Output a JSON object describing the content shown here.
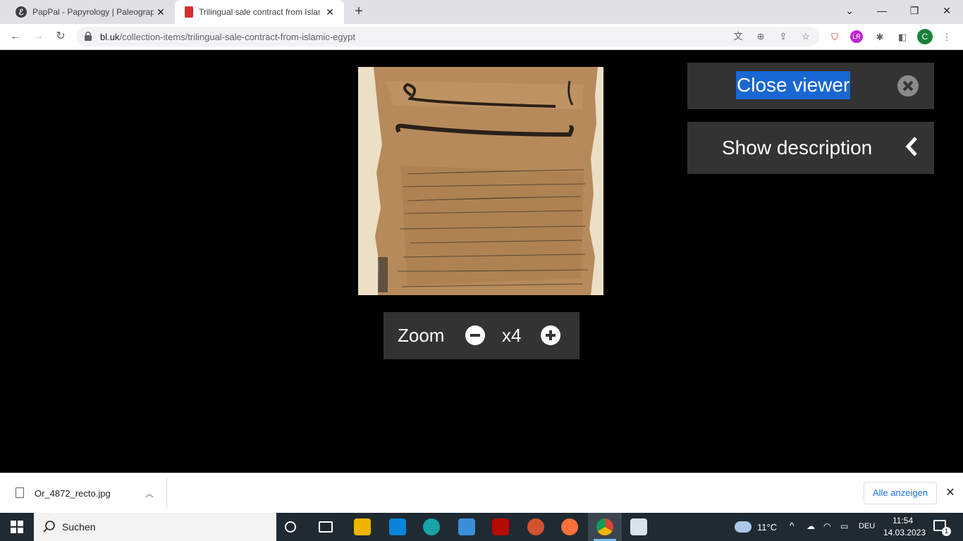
{
  "browser": {
    "tabs": [
      {
        "title": "PapPal - Papyrology | Paleograph",
        "icon": "pappal-favicon"
      },
      {
        "title": "Trilingual sale contract from Islan",
        "icon": "bl-favicon"
      }
    ],
    "url_host": "bl.uk",
    "url_path": "/collection-items/trilingual-sale-contract-from-islamic-egypt",
    "profile_initial": "C"
  },
  "viewer": {
    "close_label": "Close viewer",
    "show_description_label": "Show description",
    "zoom_label": "Zoom",
    "zoom_level": "x4",
    "image_alt": "Or_4872 recto papyrus"
  },
  "downloads": {
    "filename": "Or_4872_recto.jpg",
    "show_all_label": "Alle anzeigen"
  },
  "taskbar": {
    "search_label": "Suchen",
    "temperature": "11°C",
    "language": "DEU",
    "time": "11:54",
    "date": "14.03.2023",
    "notifications": "1"
  },
  "colors": {
    "selection": "#1967d2",
    "panel": "#333333",
    "taskbar": "#1f2a33"
  }
}
